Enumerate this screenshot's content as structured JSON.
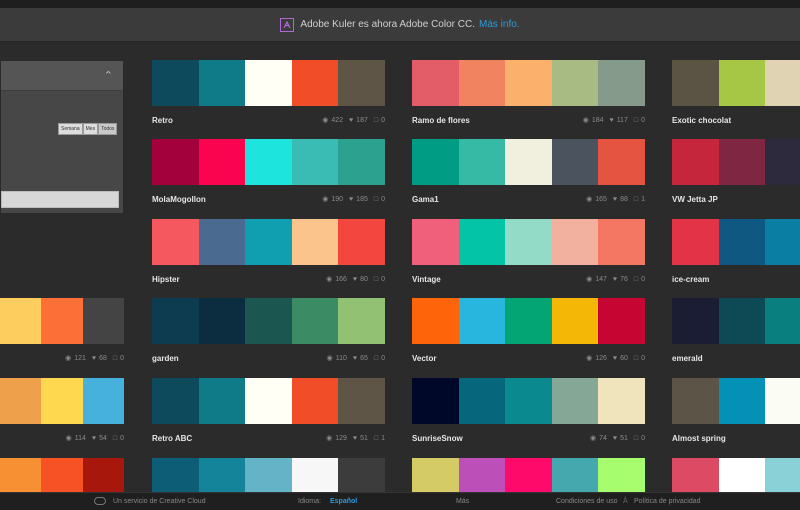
{
  "banner": {
    "text": "Adobe Kuler es ahora Adobe Color CC.",
    "link": "Más info.",
    "icon": "kuler-logo-icon",
    "accent": "#b06ad6",
    "link_color": "#2e9ad8"
  },
  "panel": {
    "filters": [
      "Semana",
      "Mes",
      "Todos"
    ]
  },
  "themes": [
    {
      "name": "Retro",
      "colors": [
        "#0d4a5c",
        "#0f7a88",
        "#fffff6",
        "#f14d28",
        "#5e5547"
      ],
      "views": "422",
      "likes": "187",
      "comments": "0"
    },
    {
      "name": "Ramo de flores",
      "colors": [
        "#e25d68",
        "#f28361",
        "#fbb06c",
        "#a8bb83",
        "#859a8b"
      ],
      "views": "184",
      "likes": "117",
      "comments": "0"
    },
    {
      "name": "Exotic chocolat",
      "colors": [
        "#5b5445",
        "#a6c646",
        "#e0d3b3"
      ],
      "views": "",
      "likes": "",
      "comments": ""
    },
    {
      "name": "MolaMogollon",
      "colors": [
        "#a3013c",
        "#fa0450",
        "#1ee4de",
        "#3abcb5",
        "#2ca190"
      ],
      "views": "190",
      "likes": "185",
      "comments": "0"
    },
    {
      "name": "Gama1",
      "colors": [
        "#009c84",
        "#36b9a5",
        "#f1efde",
        "#4b535e",
        "#e55441"
      ],
      "views": "165",
      "likes": "88",
      "comments": "1"
    },
    {
      "name": "VW Jetta JP",
      "colors": [
        "#c5263c",
        "#7e2642",
        "#2c2a3c"
      ],
      "views": "",
      "likes": "",
      "comments": ""
    },
    {
      "name": "Hipster",
      "colors": [
        "#f65860",
        "#4b6a90",
        "#0f9fb1",
        "#fbc48c",
        "#f2463f"
      ],
      "views": "166",
      "likes": "80",
      "comments": "0"
    },
    {
      "name": "Vintage",
      "colors": [
        "#f1607a",
        "#03c4a6",
        "#94dbc7",
        "#f2b19e",
        "#f47764"
      ],
      "views": "147",
      "likes": "76",
      "comments": "0"
    },
    {
      "name": "ice-cream",
      "colors": [
        "#e33347",
        "#0f5882",
        "#0a7ea3"
      ],
      "views": "",
      "likes": "",
      "comments": ""
    },
    {
      "name": "",
      "colors": [
        "#fdcd5e",
        "#fc6f37",
        "#444444"
      ],
      "views": "121",
      "likes": "68",
      "comments": "0"
    },
    {
      "name": "garden",
      "colors": [
        "#0d3b4f",
        "#0c2d40",
        "#1c5650",
        "#3b8c64",
        "#92c173"
      ],
      "views": "110",
      "likes": "65",
      "comments": "0"
    },
    {
      "name": "Vector",
      "colors": [
        "#fe6409",
        "#28b6de",
        "#04a574",
        "#f5b705",
        "#c60532"
      ],
      "views": "126",
      "likes": "60",
      "comments": "0"
    },
    {
      "name": "emerald",
      "colors": [
        "#1a1d33",
        "#0e4a55",
        "#0a7f80"
      ],
      "views": "",
      "likes": "",
      "comments": ""
    },
    {
      "name": "",
      "colors": [
        "#eea04a",
        "#fed84e",
        "#47b1dd"
      ],
      "views": "114",
      "likes": "54",
      "comments": "0"
    },
    {
      "name": "Retro ABC",
      "colors": [
        "#0d4a5c",
        "#0f7a88",
        "#fffff6",
        "#f14d28",
        "#5e5547"
      ],
      "views": "129",
      "likes": "51",
      "comments": "1"
    },
    {
      "name": "SunriseSnow",
      "colors": [
        "#00082a",
        "#06677c",
        "#0a8a8e",
        "#85a796",
        "#f0e4bd"
      ],
      "views": "74",
      "likes": "51",
      "comments": "0"
    },
    {
      "name": "Almost spring",
      "colors": [
        "#5c5446",
        "#0391b7",
        "#fbfcf4"
      ],
      "views": "",
      "likes": "",
      "comments": ""
    },
    {
      "name": "",
      "colors": [
        "#f79032",
        "#f75225",
        "#a8170b"
      ],
      "views": "",
      "likes": "",
      "comments": ""
    },
    {
      "name": "",
      "colors": [
        "#0d5d77",
        "#138499",
        "#64b3c6",
        "#f7f7f7",
        "#3c3c3c"
      ],
      "views": "",
      "likes": "",
      "comments": ""
    },
    {
      "name": "",
      "colors": [
        "#d4cb66",
        "#bd4fb8",
        "#fd0a6a",
        "#46a8af",
        "#a6fe6e"
      ],
      "views": "",
      "likes": "",
      "comments": ""
    },
    {
      "name": "",
      "colors": [
        "#dd4a63",
        "#ffffff",
        "#8ad1d7"
      ],
      "views": "",
      "likes": "",
      "comments": ""
    }
  ],
  "icons": {
    "views": "eye-icon",
    "likes": "heart-icon",
    "comments": "comment-icon"
  },
  "footer": {
    "service": "Un servicio de Creative Cloud",
    "language_label": "Idioma:",
    "language_value": "Español",
    "more": "Más",
    "terms": "Condiciones de uso",
    "privacy": "Política de privacidad"
  }
}
